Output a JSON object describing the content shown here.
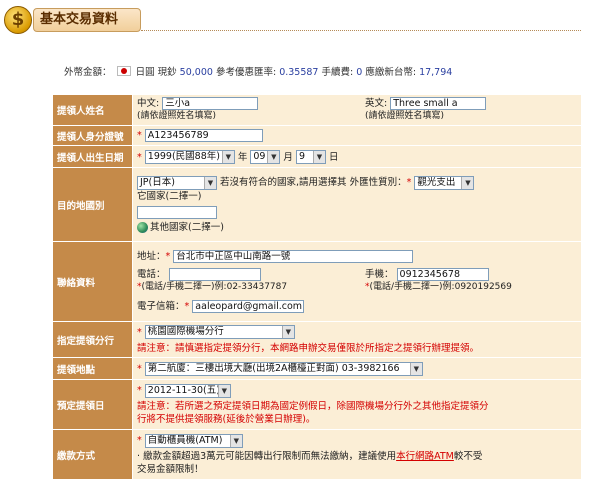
{
  "header": {
    "icon": "dollar-coin-icon",
    "coin_glyph": "$",
    "title": "基本交易資料"
  },
  "fx": {
    "label": "外幣金額：",
    "currency": "日圓",
    "cash": "現鈔",
    "amount": "50,000",
    "rate_label": "參考優惠匯率:",
    "rate": "0.35587",
    "fee_label": "手續費:",
    "fee": "0",
    "twd_label": "應繳新台幣:",
    "twd": "17,794",
    "flag_icon": "japan-flag-icon"
  },
  "rows": {
    "name": {
      "label": "提領人姓名",
      "cn_label": "中文:",
      "cn_value": "三小a",
      "cn_note": "(請依證照姓名填寫)",
      "en_label": "英文:",
      "en_value": "Three small a",
      "en_note": "(請依證照姓名填寫)"
    },
    "id": {
      "label": "提領人身分證號",
      "value": "A123456789"
    },
    "dob": {
      "label": "提領人出生日期",
      "year": "1999(民國88年)",
      "year_unit": "年",
      "month": "09",
      "month_unit": "月",
      "day": "9",
      "day_unit": "日"
    },
    "dest": {
      "label": "目的地國別",
      "country": "JP(日本)",
      "hint_a": "若沒有符合的國家,請用選擇其",
      "hint_b": "它國家(二擇一)",
      "purpose_label": "外匯性質別：",
      "purpose": "觀光支出",
      "other_label": "其他國家(二擇一)"
    },
    "contact": {
      "label": "聯絡資料",
      "addr_label": "地址：",
      "addr": "台北市中正區中山南路一號",
      "phone_label": "電話：",
      "phone": "",
      "phone_note": "(電話/手機二擇一)例:02-33437787",
      "mobile_label": "手機：",
      "mobile": "0912345678",
      "mobile_note": "(電話/手機二擇一)例:0920192569",
      "email_label": "電子信箱：",
      "email": "aaleopard@gmail.com"
    },
    "branch": {
      "label": "指定提領分行",
      "value": "桃園國際機場分行",
      "note_label": "請注意：",
      "note": "請慎選指定提領分行，本網路申辦交易僅限於所指定之提領行辦理提領。"
    },
    "location": {
      "label": "提領地點",
      "value": "第二航廈：三樓出境大廳(出境2A櫃檯正對面) 03-3982166"
    },
    "date": {
      "label": "預定提領日",
      "value": "2012-11-30(五)",
      "note_label": "請注意：",
      "note_a": "若所選之預定提領日期為國定例假日，除國際機場分行外之其他指定提領分",
      "note_b": "行將不提供提領服務(延後於營業日辦理)。"
    },
    "payment": {
      "label": "繳款方式",
      "value": "自動櫃員機(ATM)",
      "bullet": "‧",
      "note_a": "繳款金額超過3萬元可能因轉出行限制而無法繳納，建議使用",
      "link": "本行網路ATM",
      "note_b": "較不受",
      "note_c": "交易金額限制！"
    }
  },
  "colors": {
    "label_bg": "#c58a49",
    "value_bg": "#fbeed6",
    "required": "#d40000",
    "header_text": "#5a2d00"
  }
}
